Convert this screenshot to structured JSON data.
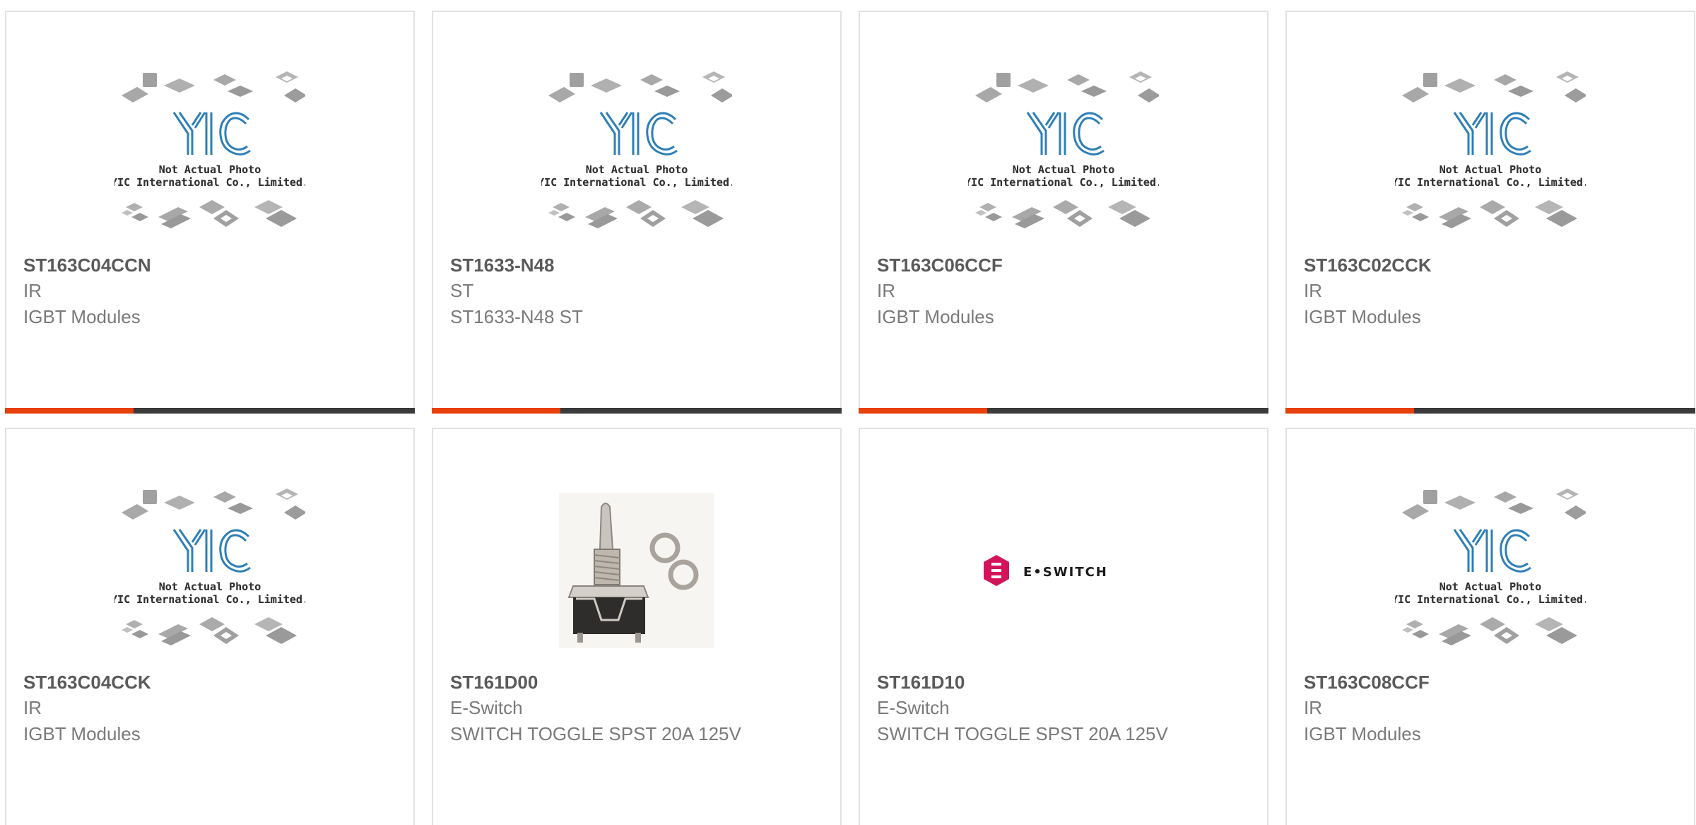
{
  "placeholder": {
    "logo": "YIC",
    "line1": "Not Actual Photo",
    "line2": "YIC International Co., Limited."
  },
  "eswitch_logo_text": "E•SWITCH",
  "colors": {
    "accent": "#e8400c",
    "bar": "#3b3b3b",
    "yic_blue": "#2d7fb8"
  },
  "products": [
    {
      "part": "ST163C04CCN",
      "mfr": "IR",
      "desc": "IGBT Modules",
      "image": "yic-placeholder"
    },
    {
      "part": "ST1633-N48",
      "mfr": "ST",
      "desc": "ST1633-N48 ST",
      "image": "yic-placeholder"
    },
    {
      "part": "ST163C06CCF",
      "mfr": "IR",
      "desc": "IGBT Modules",
      "image": "yic-placeholder"
    },
    {
      "part": "ST163C02CCK",
      "mfr": "IR",
      "desc": "IGBT Modules",
      "image": "yic-placeholder"
    },
    {
      "part": "ST163C04CCK",
      "mfr": "IR",
      "desc": "IGBT Modules",
      "image": "yic-placeholder"
    },
    {
      "part": "ST161D00",
      "mfr": "E-Switch",
      "desc": "SWITCH TOGGLE SPST 20A 125V",
      "image": "toggle-switch-photo"
    },
    {
      "part": "ST161D10",
      "mfr": "E-Switch",
      "desc": "SWITCH TOGGLE SPST 20A 125V",
      "image": "eswitch-logo"
    },
    {
      "part": "ST163C08CCF",
      "mfr": "IR",
      "desc": "IGBT Modules",
      "image": "yic-placeholder"
    }
  ]
}
